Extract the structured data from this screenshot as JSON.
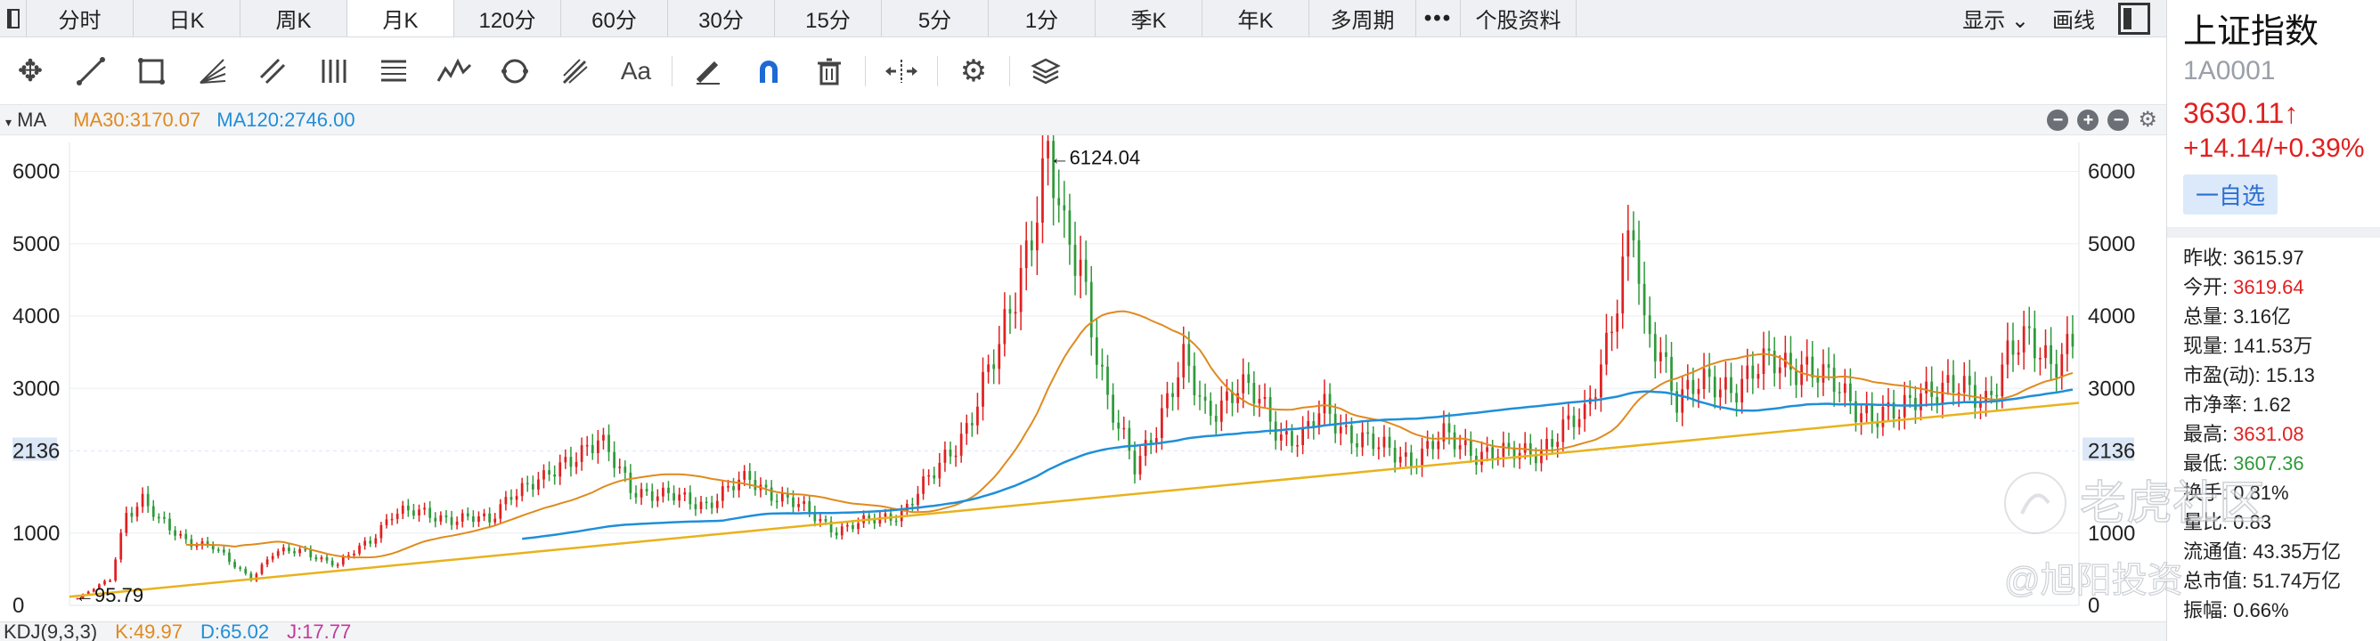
{
  "tabs": {
    "items": [
      "分时",
      "日K",
      "周K",
      "月K",
      "120分",
      "60分",
      "30分",
      "15分",
      "5分",
      "1分",
      "季K",
      "年K",
      "多周期",
      "•••",
      "个股资料"
    ],
    "active_index": 3,
    "display_label": "显示",
    "draw_label": "画线"
  },
  "toolbar": {
    "text_tool": "Aa"
  },
  "indicator": {
    "label": "MA",
    "ma30": "MA30:3170.07",
    "ma120": "MA120:2746.00",
    "ma30_color": "#e08a1e",
    "ma120_color": "#1f8fd8"
  },
  "kdj": {
    "label": "KDJ(9,3,3)",
    "k": "K:49.97",
    "d": "D:65.02",
    "j": "J:17.77"
  },
  "chart_data": {
    "type": "candlestick",
    "y_ticks": [
      "6000",
      "5000",
      "4000",
      "3000",
      "2136",
      "1000",
      "0"
    ],
    "y_tick_values": [
      6000,
      5000,
      4000,
      3000,
      2136,
      1000,
      0
    ],
    "ylim": [
      0,
      6400
    ],
    "max_label": "←6124.04",
    "max_value": 6124.04,
    "min_label": "←95.79",
    "min_value": 95.79,
    "highlight_label": "2136",
    "trendline": {
      "from": 120,
      "to": 2800,
      "color": "#e8b21c"
    },
    "up_color": "#e02020",
    "down_color": "#2f9a3a",
    "ma30_color": "#e08a1e",
    "ma120_color": "#1f8fd8",
    "anchors": [
      [
        0,
        100
      ],
      [
        6,
        360
      ],
      [
        9,
        1300
      ],
      [
        12,
        1450
      ],
      [
        15,
        1150
      ],
      [
        20,
        920
      ],
      [
        25,
        800
      ],
      [
        28,
        600
      ],
      [
        32,
        380
      ],
      [
        36,
        720
      ],
      [
        42,
        750
      ],
      [
        48,
        560
      ],
      [
        54,
        900
      ],
      [
        58,
        1300
      ],
      [
        64,
        1250
      ],
      [
        72,
        1200
      ],
      [
        76,
        1150
      ],
      [
        80,
        1600
      ],
      [
        86,
        1700
      ],
      [
        92,
        2150
      ],
      [
        96,
        2250
      ],
      [
        102,
        1650
      ],
      [
        108,
        1500
      ],
      [
        116,
        1420
      ],
      [
        124,
        1750
      ],
      [
        132,
        1400
      ],
      [
        140,
        1050
      ],
      [
        146,
        1150
      ],
      [
        152,
        1300
      ],
      [
        158,
        1800
      ],
      [
        164,
        2500
      ],
      [
        170,
        3500
      ],
      [
        174,
        4700
      ],
      [
        177,
        5600
      ],
      [
        179,
        6124
      ],
      [
        182,
        5000
      ],
      [
        185,
        4800
      ],
      [
        188,
        3600
      ],
      [
        190,
        2800
      ],
      [
        192,
        2400
      ],
      [
        195,
        1900
      ],
      [
        200,
        2700
      ],
      [
        204,
        3300
      ],
      [
        208,
        2700
      ],
      [
        214,
        3000
      ],
      [
        218,
        2800
      ],
      [
        222,
        2400
      ],
      [
        226,
        2300
      ],
      [
        230,
        2700
      ],
      [
        234,
        2450
      ],
      [
        240,
        2150
      ],
      [
        246,
        2050
      ],
      [
        252,
        2300
      ],
      [
        258,
        2150
      ],
      [
        264,
        2050
      ],
      [
        270,
        2200
      ],
      [
        274,
        2400
      ],
      [
        278,
        2600
      ],
      [
        282,
        3700
      ],
      [
        285,
        4600
      ],
      [
        287,
        5100
      ],
      [
        289,
        3700
      ],
      [
        292,
        3600
      ],
      [
        295,
        2900
      ],
      [
        300,
        3000
      ],
      [
        306,
        3100
      ],
      [
        312,
        3300
      ],
      [
        318,
        3400
      ],
      [
        322,
        3100
      ],
      [
        326,
        2900
      ],
      [
        332,
        2600
      ],
      [
        336,
        2600
      ],
      [
        340,
        3050
      ],
      [
        346,
        2950
      ],
      [
        352,
        2900
      ],
      [
        356,
        3450
      ],
      [
        360,
        3600
      ],
      [
        364,
        3450
      ],
      [
        368,
        3630
      ]
    ]
  },
  "panel": {
    "name": "上证指数",
    "code": "1A0001",
    "price": "3630.11",
    "price_arrow": "↑",
    "change": "+14.14/+0.39%",
    "fav_label": "一自选",
    "rows": [
      {
        "label": "昨收:",
        "value": "3615.97",
        "tone": ""
      },
      {
        "label": "今开:",
        "value": "3619.64",
        "tone": "red"
      },
      {
        "label": "总量:",
        "value": "3.16亿",
        "tone": ""
      },
      {
        "label": "现量:",
        "value": "141.53万",
        "tone": ""
      },
      {
        "label": "市盈(动):",
        "value": "15.13",
        "tone": ""
      },
      {
        "label": "市净率:",
        "value": "1.62",
        "tone": ""
      },
      {
        "label": "最高:",
        "value": "3631.08",
        "tone": "red"
      },
      {
        "label": "最低:",
        "value": "3607.36",
        "tone": "green"
      },
      {
        "label": "换手:",
        "value": "0.81%",
        "tone": ""
      },
      {
        "label": "量比:",
        "value": "0.83",
        "tone": ""
      },
      {
        "label": "流通值:",
        "value": "43.35万亿",
        "tone": ""
      },
      {
        "label": "总市值:",
        "value": "51.74万亿",
        "tone": ""
      },
      {
        "label": "振幅:",
        "value": "0.66%",
        "tone": ""
      }
    ]
  },
  "watermark": {
    "brand": "老虎社区",
    "user": "@旭阳投资"
  }
}
